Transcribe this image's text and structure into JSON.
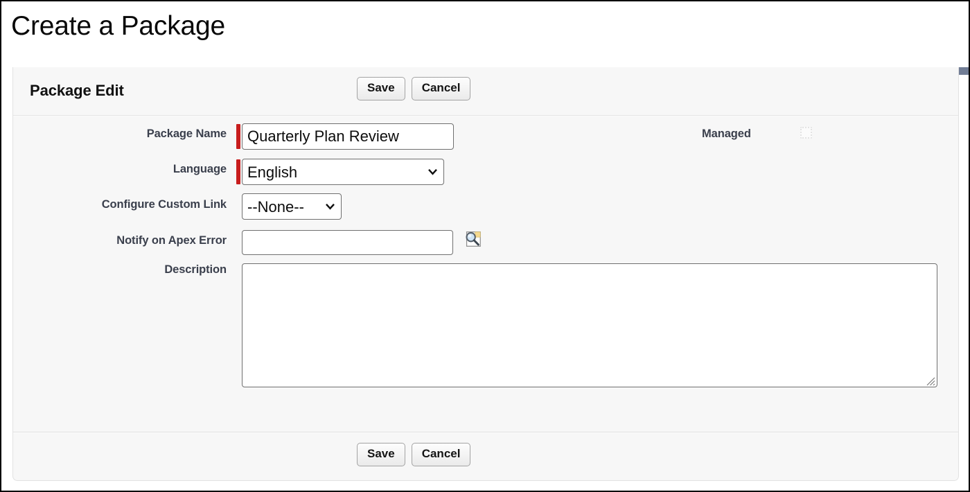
{
  "page": {
    "title": "Create a Package"
  },
  "panel": {
    "header_title": "Package Edit",
    "top_actions": {
      "save_label": "Save",
      "cancel_label": "Cancel"
    },
    "footer_actions": {
      "save_label": "Save",
      "cancel_label": "Cancel"
    }
  },
  "form": {
    "fields": [
      {
        "key": "package_name",
        "label": "Package Name",
        "type": "text",
        "required": true,
        "value": "Quarterly Plan Review",
        "placeholder": ""
      },
      {
        "key": "language",
        "label": "Language",
        "type": "select",
        "required": true,
        "value": "English",
        "options": [
          "English"
        ]
      },
      {
        "key": "configure_custom_link",
        "label": "Configure Custom Link",
        "type": "select",
        "required": false,
        "value": "--None--",
        "options": [
          "--None--"
        ]
      },
      {
        "key": "notify_on_apex_error",
        "label": "Notify on Apex Error",
        "type": "lookup",
        "required": false,
        "value": "",
        "placeholder": "",
        "lookup_icon": "lookup-search-icon"
      },
      {
        "key": "description",
        "label": "Description",
        "type": "textarea",
        "required": false,
        "value": "",
        "placeholder": ""
      }
    ],
    "managed": {
      "label": "Managed",
      "checked": false,
      "disabled": true
    }
  },
  "colors": {
    "accent_bar": "#717d95",
    "required_marker": "#c81d1d",
    "panel_background": "#f7f7f7",
    "label_text": "#3a3f4c",
    "input_border": "#6f6f6f",
    "frame_border": "#000000"
  },
  "icons": {
    "chevron_down": "chevron-down-icon",
    "textarea_resize": "resize-grip-icon"
  }
}
